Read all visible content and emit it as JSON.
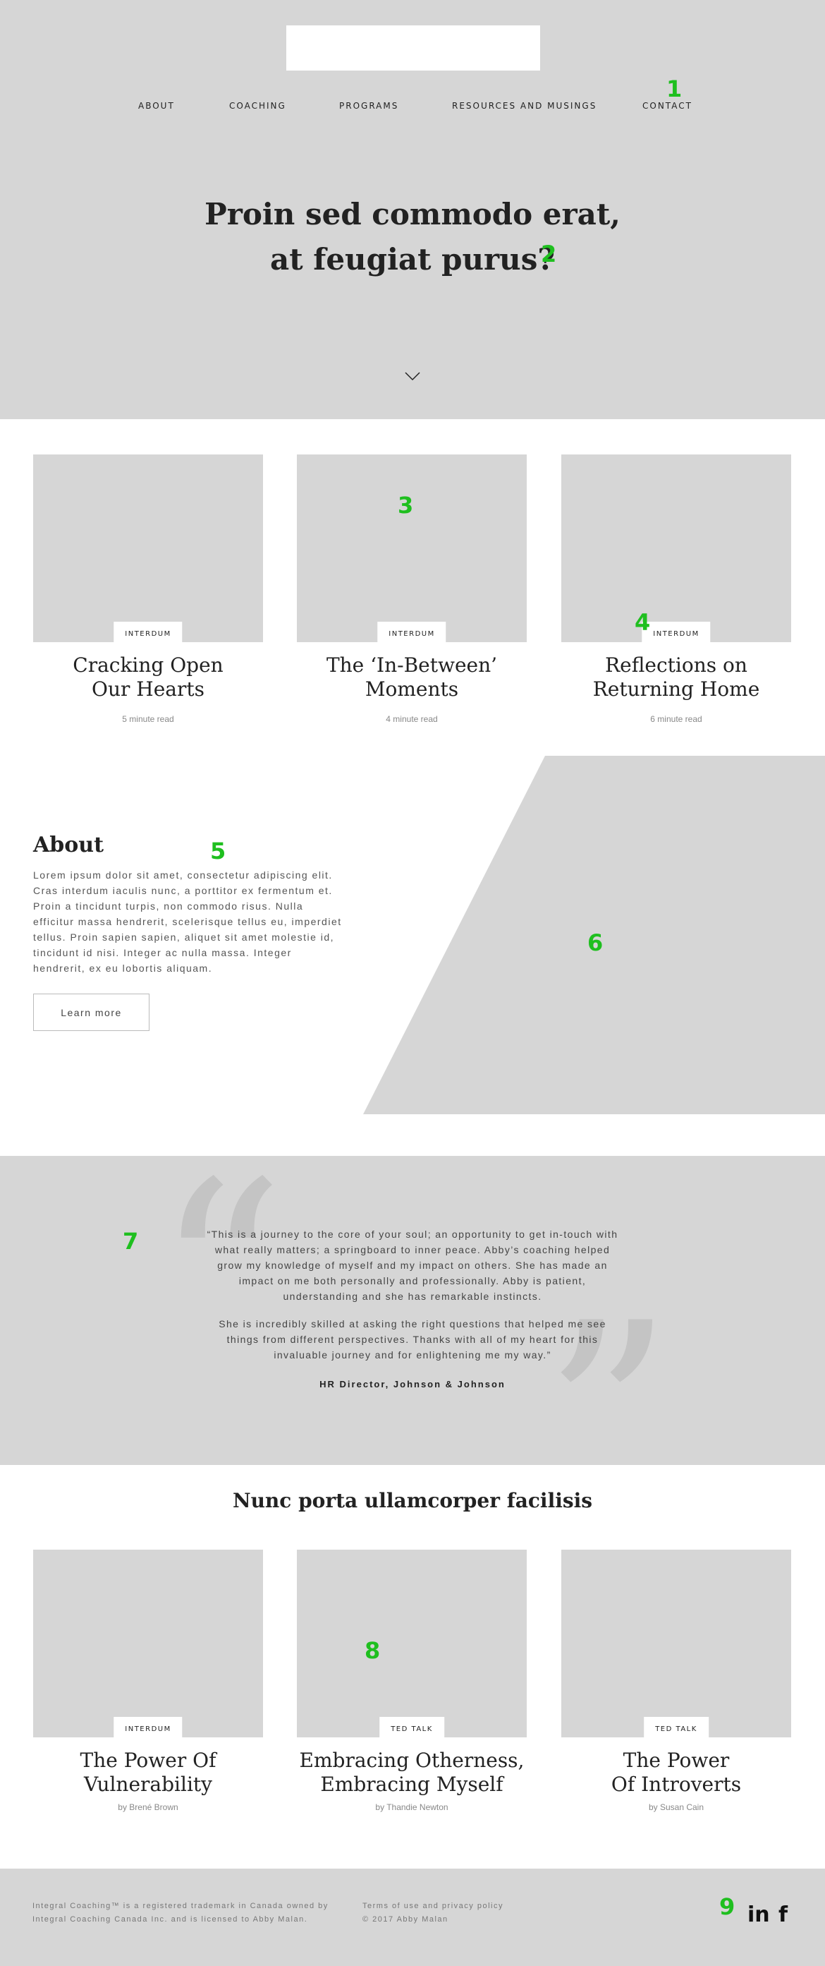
{
  "nav": {
    "items": [
      "ABOUT",
      "COACHING",
      "PROGRAMS",
      "RESOURCES AND MUSINGS",
      "CONTACT"
    ]
  },
  "hero": {
    "title_line1": "Proin sed commodo erat,",
    "title_line2": "at feugiat purus?"
  },
  "articles": [
    {
      "tag": "INTERDUM",
      "title_line1": "Cracking Open",
      "title_line2": "Our Hearts",
      "meta": "5 minute read"
    },
    {
      "tag": "INTERDUM",
      "title_line1": "The ‘In-Between’",
      "title_line2": "Moments",
      "meta": "4 minute read"
    },
    {
      "tag": "INTERDUM",
      "title_line1": "Reflections on",
      "title_line2": "Returning Home",
      "meta": "6 minute read"
    }
  ],
  "about": {
    "title": "About",
    "text": "Lorem ipsum dolor sit amet, consectetur adipiscing elit. Cras interdum iaculis nunc, a porttitor ex fermentum et. Proin a tincidunt turpis, non commodo risus. Nulla efficitur massa hendrerit, scelerisque tellus eu, imperdiet tellus. Proin sapien sapien, aliquet sit amet molestie id, tincidunt id nisi. Integer ac nulla massa. Integer hendrerit, ex eu lobortis aliquam.",
    "button": "Learn more"
  },
  "testimonial": {
    "p1": "“This is a journey to the core of your soul; an opportunity to get in-touch with what really matters; a springboard to inner peace. Abby’s coaching helped grow my knowledge of myself and my impact on others. She has made an impact on me both personally and professionally. Abby is patient, understanding and she has remarkable instincts.",
    "p2": "She is incredibly skilled at asking the right questions that helped me see things from different perspectives. Thanks with all of my heart for this invaluable journey and for enlightening me my way.”",
    "author": "HR Director, Johnson & Johnson",
    "open_mark": "“",
    "close_mark": "”"
  },
  "talks": {
    "title": "Nunc porta ullamcorper facilisis",
    "items": [
      {
        "tag": "INTERDUM",
        "title_line1": "The Power Of",
        "title_line2": "Vulnerability",
        "meta": "by Brené Brown"
      },
      {
        "tag": "TED TALK",
        "title_line1": "Embracing Otherness,",
        "title_line2": "Embracing Myself",
        "meta": "by Thandie Newton"
      },
      {
        "tag": "TED TALK",
        "title_line1": "The Power",
        "title_line2": "Of Introverts",
        "meta": "by Susan Cain"
      }
    ]
  },
  "footer": {
    "trademark_line1": "Integral Coaching™ is a registered trademark in Canada owned by",
    "trademark_line2": "Integral Coaching Canada Inc. and is licensed to Abby Malan.",
    "terms": "Terms of use and privacy policy",
    "copyright": "© 2017 Abby Malan",
    "linkedin": "in",
    "facebook": "f"
  },
  "annotations": [
    "1",
    "2",
    "3",
    "4",
    "5",
    "6",
    "7",
    "8",
    "9"
  ],
  "colors": {
    "placeholder": "#d6d6d6",
    "annotation": "#1fbf1f"
  }
}
